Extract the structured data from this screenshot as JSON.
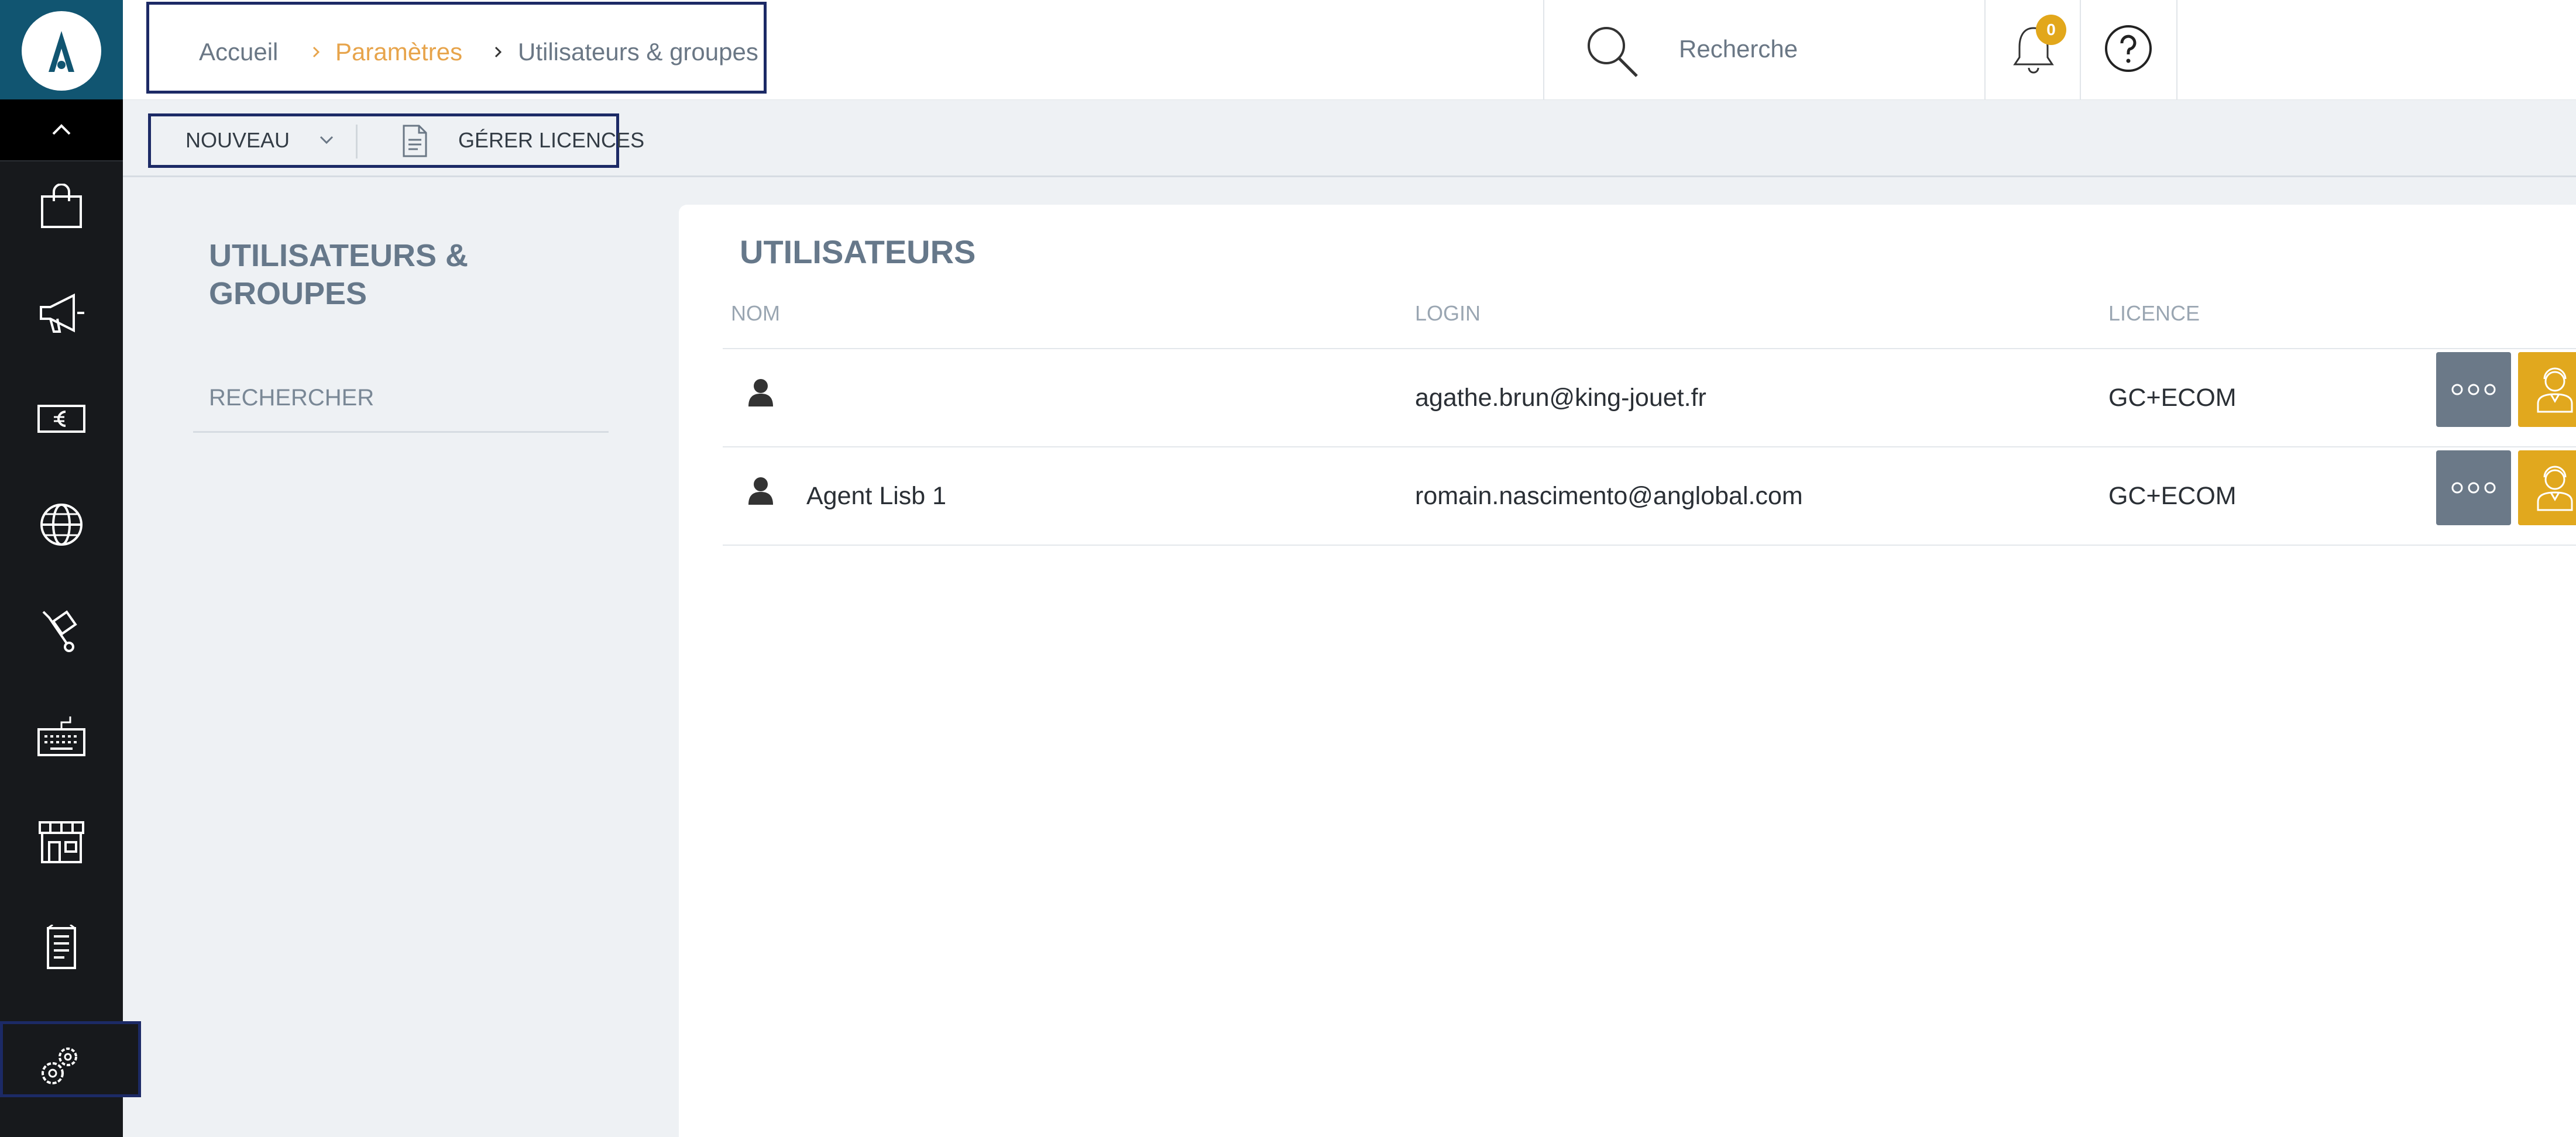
{
  "app": {
    "logo_icon": "brand-logo-icon",
    "brand_color": "#115571",
    "accent_color": "#e2a71b"
  },
  "sidebar": {
    "collapse_icon": "chevron-up-icon",
    "items": [
      {
        "icon": "shopping-bag-icon"
      },
      {
        "icon": "megaphone-icon"
      },
      {
        "icon": "euro-banknote-icon"
      },
      {
        "icon": "globe-icon"
      },
      {
        "icon": "hand-truck-icon"
      },
      {
        "icon": "keyboard-icon"
      },
      {
        "icon": "store-icon"
      },
      {
        "icon": "receipt-icon"
      },
      {
        "icon": "settings-gears-icon",
        "active": true
      }
    ]
  },
  "header": {
    "breadcrumb": [
      "Accueil",
      "Paramètres",
      "Utilisateurs & groupes"
    ],
    "search": {
      "placeholder": "Recherche"
    },
    "notifications": {
      "count": "0"
    },
    "help_icon": "question-mark-icon"
  },
  "toolbar": {
    "new_label": "NOUVEAU",
    "licences_label": "GÉRER LICENCES"
  },
  "left_panel": {
    "title": "UTILISATEURS & GROUPES",
    "search_label": "RECHERCHER"
  },
  "users": {
    "title": "UTILISATEURS",
    "columns": {
      "name": "NOM",
      "login": "LOGIN",
      "license": "LICENCE"
    },
    "rows": [
      {
        "name": "",
        "login": "agathe.brun@king-jouet.fr",
        "license": "GC+ECOM"
      },
      {
        "name": "Agent Lisb 1",
        "login": "romain.nascimento@anglobal.com",
        "license": "GC+ECOM"
      }
    ]
  }
}
